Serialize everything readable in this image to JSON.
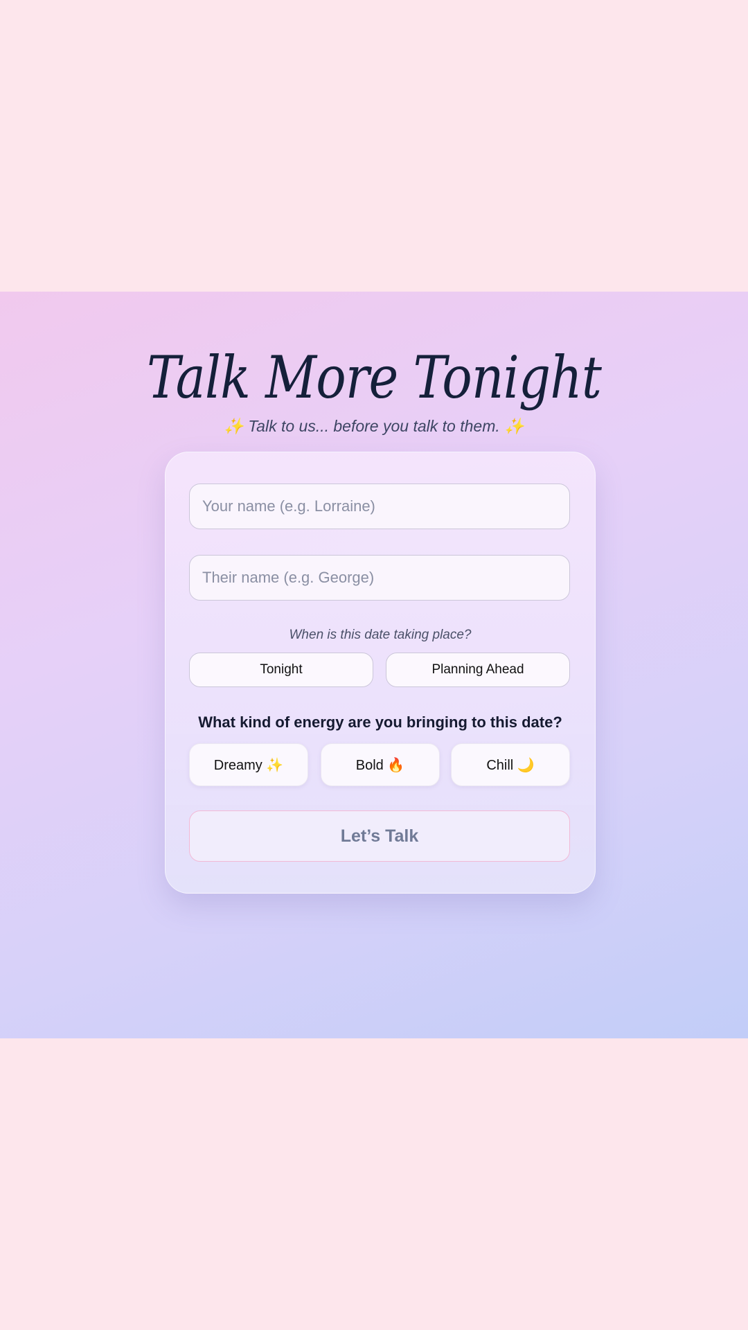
{
  "app": {
    "title": "Talk More Tonight",
    "subtitle": "Talk to us... before you talk to them.",
    "subtitle_decoration": "✨"
  },
  "form": {
    "your_name": {
      "value": "",
      "placeholder": "Your name (e.g. Lorraine)"
    },
    "their_name": {
      "value": "",
      "placeholder": "Their name (e.g. George)"
    },
    "when_label": "When is this date taking place?",
    "when_options": [
      {
        "label": "Tonight"
      },
      {
        "label": "Planning Ahead"
      }
    ],
    "energy_title": "What kind of energy are you bringing to this date?",
    "energy_options": [
      {
        "label": "Dreamy",
        "emoji": "✨",
        "icon": "sparkles-icon"
      },
      {
        "label": "Bold",
        "emoji": "🔥",
        "icon": "fire-icon"
      },
      {
        "label": "Chill",
        "emoji": "🌙",
        "icon": "crescent-moon-icon"
      }
    ],
    "submit_label": "Let’s Talk"
  },
  "colors": {
    "page_background": "#fde6ec",
    "gradient_top": "#f1c9ee",
    "gradient_bottom": "#c2cdf8",
    "title_color": "#15203a",
    "submit_border": "#f2b9d6",
    "submit_text": "#707a96"
  }
}
